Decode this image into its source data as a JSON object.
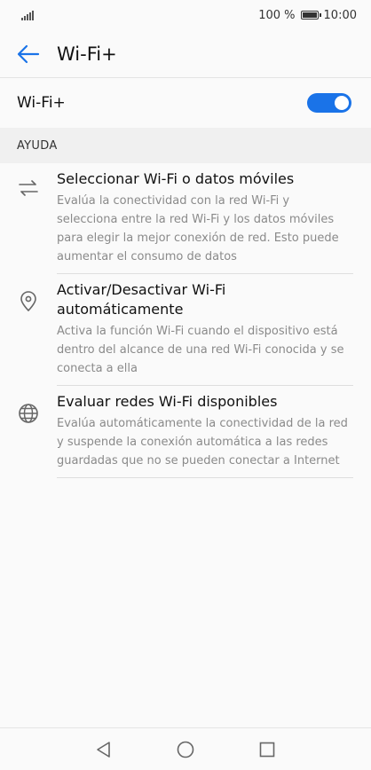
{
  "status_bar": {
    "battery": "100 %",
    "time": "10:00"
  },
  "app_bar": {
    "title": "Wi-Fi+"
  },
  "toggle": {
    "label": "Wi-Fi+",
    "state": "on",
    "accent": "#1a73e8"
  },
  "section": {
    "title": "AYUDA"
  },
  "help_items": [
    {
      "icon": "swap-arrows-icon",
      "title": "Seleccionar Wi-Fi o datos móviles",
      "description": "Evalúa la conectividad con la red Wi-Fi y selecciona entre la red Wi-Fi y los datos móviles para elegir la mejor conexión de red. Esto puede aumentar el consumo de datos"
    },
    {
      "icon": "location-pin-icon",
      "title": "Activar/Desactivar Wi-Fi automáticamente",
      "description": "Activa la función Wi-Fi cuando el dispositivo está dentro del alcance de una red Wi-Fi conocida y se conecta a ella"
    },
    {
      "icon": "globe-icon",
      "title": "Evaluar redes Wi-Fi disponibles",
      "description": "Evalúa automáticamente la conectividad de la red y suspende la conexión automática a las redes guardadas que no se pueden conectar a Internet"
    }
  ],
  "nav_bar": {
    "buttons": [
      "back-triangle-icon",
      "home-circle-icon",
      "recents-square-icon"
    ]
  }
}
